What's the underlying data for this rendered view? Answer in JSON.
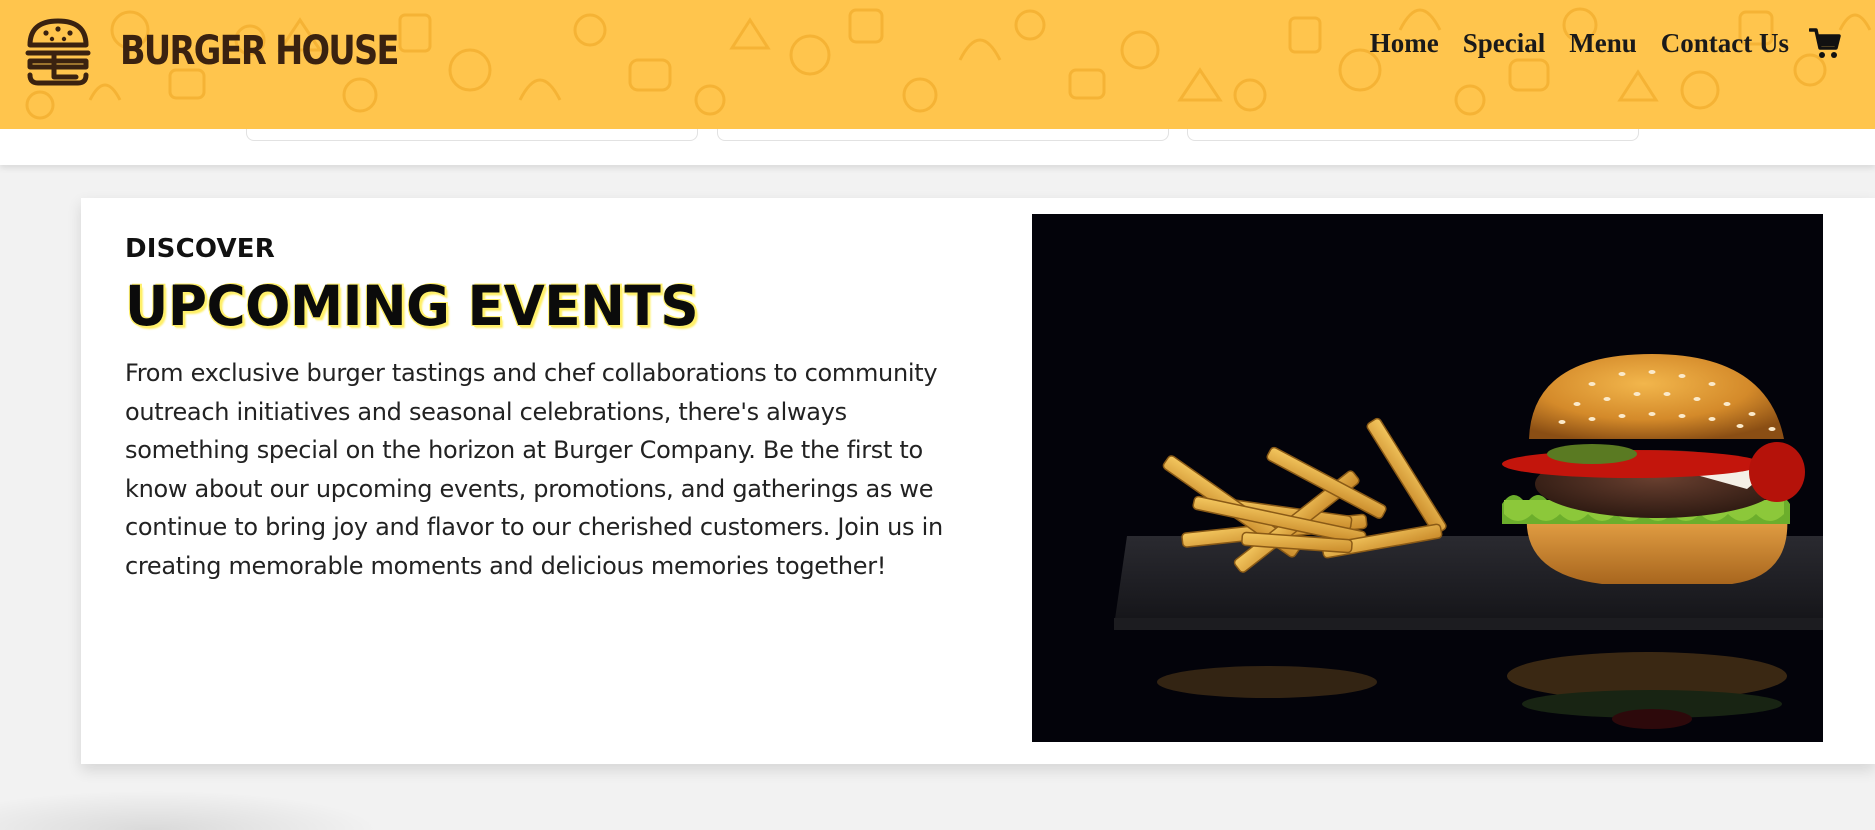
{
  "header": {
    "brand": "BURGER HOUSE",
    "brand_icon": "burger-logo-icon",
    "nav": [
      {
        "label": "Home"
      },
      {
        "label": "Special"
      },
      {
        "label": "Menu"
      },
      {
        "label": "Contact Us"
      }
    ],
    "cart_icon": "shopping-cart-icon",
    "background_color": "#ffc54d"
  },
  "events": {
    "eyebrow": "DISCOVER",
    "title": "UPCOMING EVENTS",
    "description": "From exclusive burger tastings and chef collaborations to community outreach initiatives and seasonal celebrations, there's always something special on the horizon at Burger Company. Be the first to know about our upcoming events, promotions, and gatherings as we continue to bring joy and flavor to our cherished customers. Join us in creating memorable moments and delicious memories together!",
    "title_highlight_color": "#fff06a"
  }
}
